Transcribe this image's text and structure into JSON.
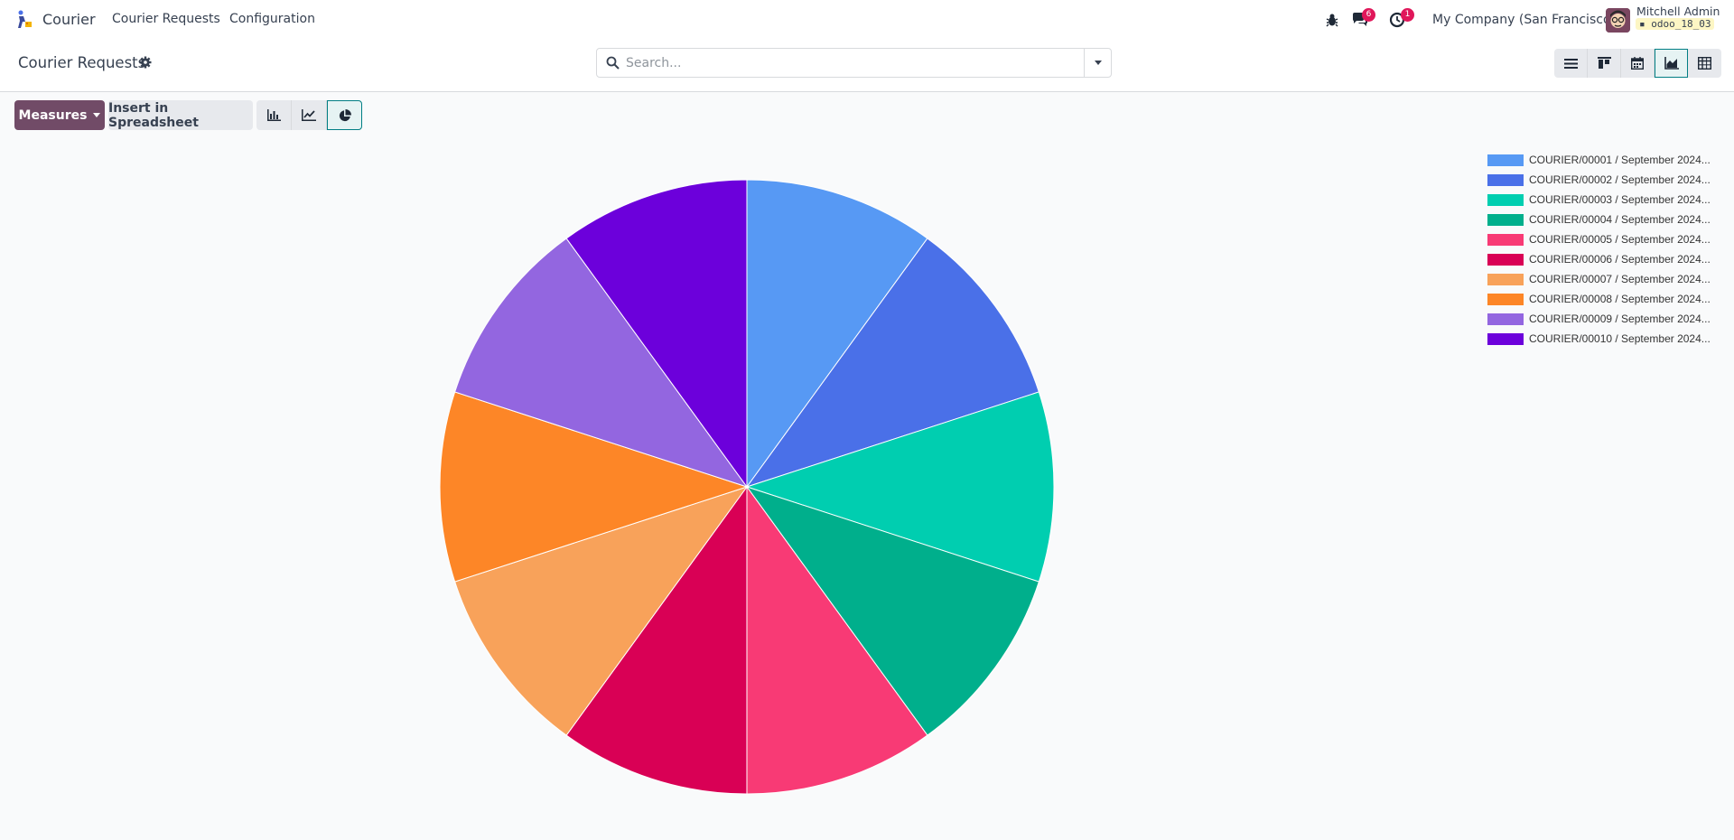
{
  "navbar": {
    "app_name": "Courier",
    "menus": [
      "Courier Requests",
      "Configuration"
    ],
    "chat_badge": "6",
    "activity_badge": "1",
    "company": "My Company (San Francisco)",
    "user_name": "Mitchell Admin",
    "db_name": "odoo_18_03"
  },
  "control_panel": {
    "title": "Courier Requests",
    "search_placeholder": "Search...",
    "views": [
      "list-view-icon",
      "kanban-view-icon",
      "calendar-view-icon",
      "graph-view-icon",
      "pivot-view-icon"
    ],
    "active_view": "graph-view-icon"
  },
  "toolbar": {
    "measures_label": "Measures",
    "spreadsheet_label": "Insert in Spreadsheet",
    "active_chart": "pie"
  },
  "colors": {
    "brand": "#714b67",
    "accent": "#017e84"
  },
  "chart_data": {
    "type": "pie",
    "legend_position": "top-right",
    "slices": [
      {
        "label": "COURIER/00001 / September 2024...",
        "value": 1,
        "color": "#5799f4"
      },
      {
        "label": "COURIER/00002 / September 2024...",
        "value": 1,
        "color": "#4a70e8"
      },
      {
        "label": "COURIER/00003 / September 2024...",
        "value": 1,
        "color": "#00ceb0"
      },
      {
        "label": "COURIER/00004 / September 2024...",
        "value": 1,
        "color": "#00af8c"
      },
      {
        "label": "COURIER/00005 / September 2024...",
        "value": 1,
        "color": "#f83a75"
      },
      {
        "label": "COURIER/00006 / September 2024...",
        "value": 1,
        "color": "#d90055"
      },
      {
        "label": "COURIER/00007 / September 2024...",
        "value": 1,
        "color": "#f8a25a"
      },
      {
        "label": "COURIER/00008 / September 2024...",
        "value": 1,
        "color": "#fd8627"
      },
      {
        "label": "COURIER/00009 / September 2024...",
        "value": 1,
        "color": "#9366e0"
      },
      {
        "label": "COURIER/00010 / September 2024...",
        "value": 1,
        "color": "#6c00db"
      }
    ]
  }
}
